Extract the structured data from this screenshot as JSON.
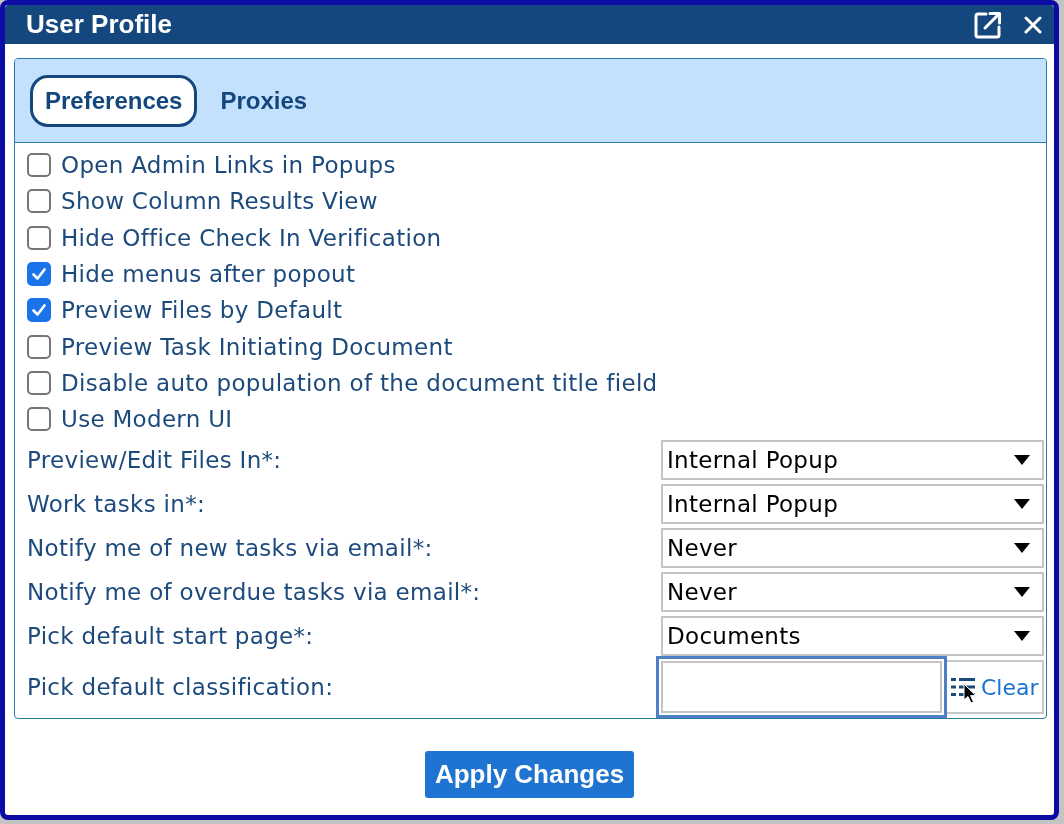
{
  "window": {
    "title": "User Profile"
  },
  "tabs": [
    {
      "label": "Preferences",
      "selected": true
    },
    {
      "label": "Proxies",
      "selected": false
    }
  ],
  "options": [
    {
      "label": "Open Admin Links in Popups",
      "checked": false
    },
    {
      "label": "Show Column Results View",
      "checked": false
    },
    {
      "label": "Hide Office Check In Verification",
      "checked": false
    },
    {
      "label": "Hide menus after popout",
      "checked": true
    },
    {
      "label": "Preview Files by Default",
      "checked": true
    },
    {
      "label": "Preview Task Initiating Document",
      "checked": false
    },
    {
      "label": "Disable auto population of the document title field",
      "checked": false
    },
    {
      "label": "Use Modern UI",
      "checked": false
    }
  ],
  "settings": [
    {
      "kind": "dropdown",
      "label": "Preview/Edit Files In*:",
      "value": "Internal Popup"
    },
    {
      "kind": "dropdown",
      "label": "Work tasks in*:",
      "value": "Internal Popup"
    },
    {
      "kind": "dropdown",
      "label": "Notify me of new tasks via email*:",
      "value": "Never"
    },
    {
      "kind": "dropdown",
      "label": "Notify me of overdue tasks via email*:",
      "value": "Never"
    },
    {
      "kind": "dropdown",
      "label": "Pick default start page*:",
      "value": "Documents"
    },
    {
      "kind": "picker",
      "label": "Pick default classification:",
      "link": "Clear",
      "focused": true
    }
  ],
  "buttons": [
    {
      "label": "Apply Changes"
    }
  ]
}
